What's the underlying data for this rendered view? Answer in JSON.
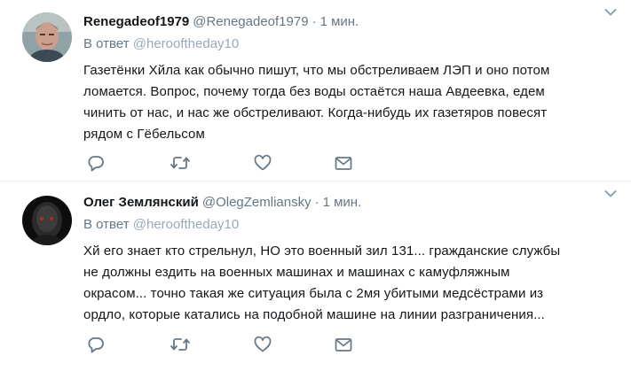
{
  "tweets": [
    {
      "fullname": "Renegadeof1979",
      "username": "@Renegadeof1979",
      "separator": "·",
      "time": "1 мин.",
      "reply_prefix": "В ответ",
      "reply_to": "@herooftheday10",
      "text": "Газетёнки Хйла как обычно пишут, что мы обстреливаем ЛЭП и оно потом\nломается. Вопрос, почему тогда без воды остаётся наша Авдеевка, едем\nчинить от нас, и нас же обстреливают. Когда-нибудь их газетяров повесят\nрядом с Гёбельсом",
      "actions": [
        "reply-icon",
        "retweet-icon",
        "like-icon",
        "direct-message-icon"
      ]
    },
    {
      "fullname": "Олег Землянский",
      "username": "@OlegZemliansky",
      "separator": "·",
      "time": "1 мин.",
      "reply_prefix": "В ответ",
      "reply_to": "@herooftheday10",
      "text": "Хй его знает кто стрельнул, НО это военный зил 131... гражданские службы\nне должны ездить на военных машинах и машинах с камуфляжным\nокрасом... точно такая же ситуация была с 2мя убитыми медсёстрами из\nордло, которые катались на подобной машине на линии разграничения...",
      "actions": [
        "reply-icon",
        "retweet-icon",
        "like-icon",
        "direct-message-icon"
      ]
    }
  ],
  "colors": {
    "text": "#14171a",
    "secondary": "#657786",
    "link_muted": "#9aa9b7",
    "divider": "#e6ecf0",
    "icon": "#657786"
  }
}
